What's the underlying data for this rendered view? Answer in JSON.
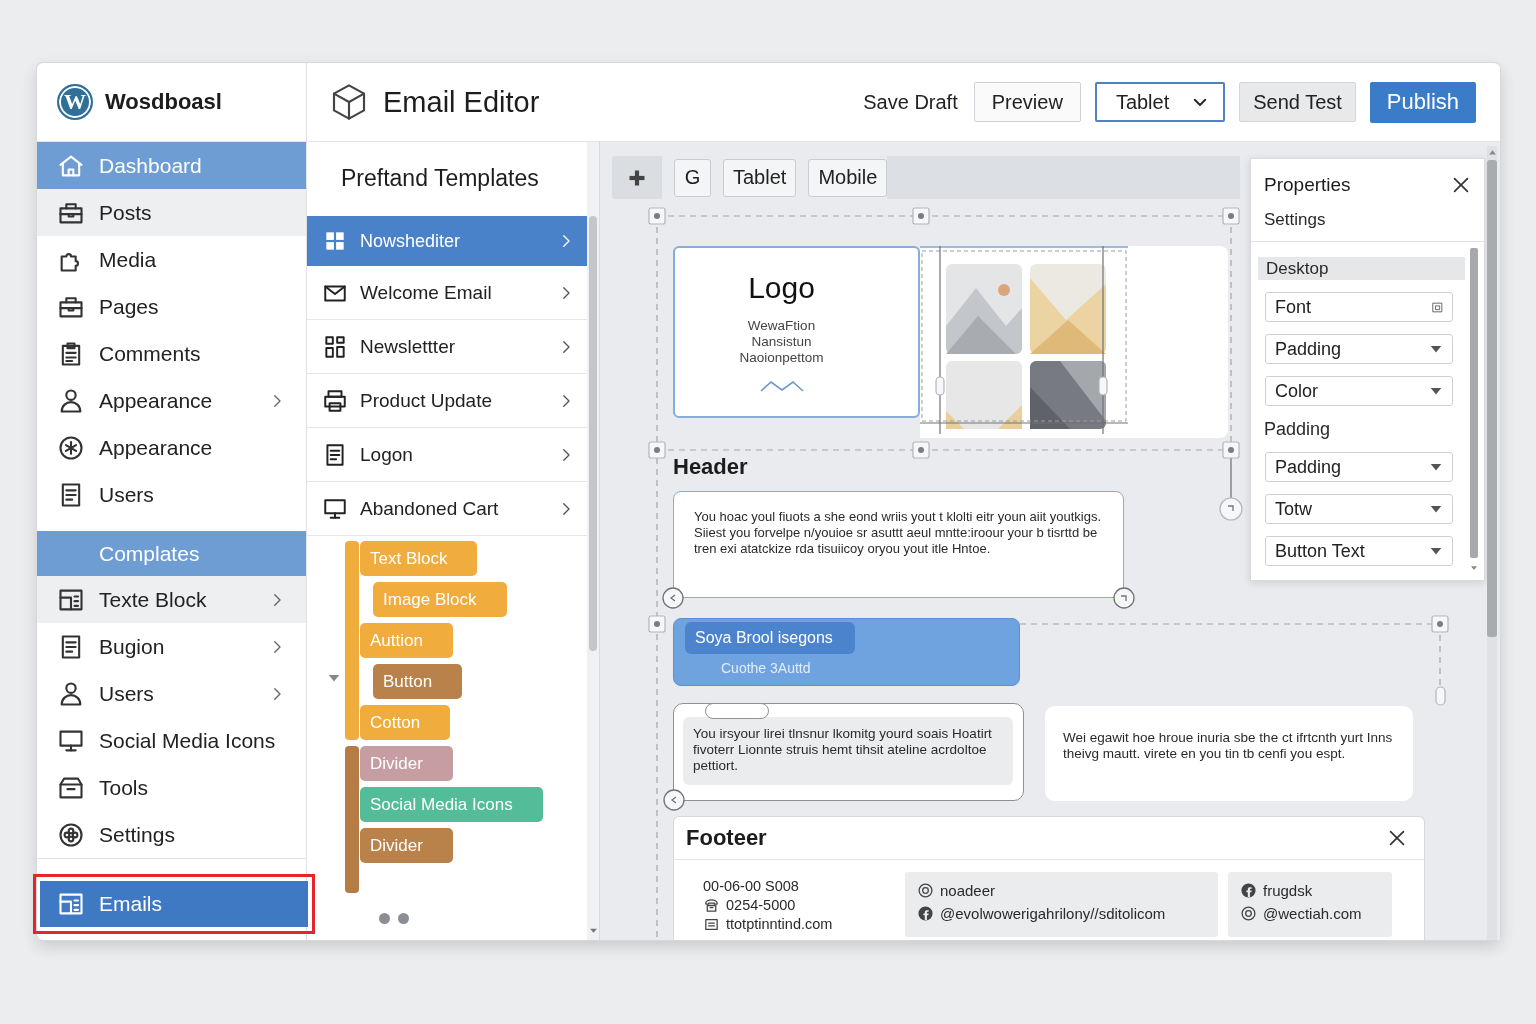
{
  "sidebar": {
    "brand": {
      "logo_mark": "W",
      "name": "Wosdboasl"
    },
    "sections": [
      {
        "items": [
          {
            "label": "Dashboard",
            "selected": true,
            "hovered": false,
            "has_submenu": false
          },
          {
            "label": "Posts",
            "selected": false,
            "hovered": true,
            "has_submenu": false
          },
          {
            "label": "Media",
            "selected": false,
            "hovered": false,
            "has_submenu": false
          },
          {
            "label": "Pages",
            "selected": false,
            "hovered": false,
            "has_submenu": false
          },
          {
            "label": "Comments",
            "selected": false,
            "hovered": false,
            "has_submenu": false
          },
          {
            "label": "Appearance",
            "selected": false,
            "hovered": false,
            "has_submenu": true
          },
          {
            "label": "Appearance",
            "selected": false,
            "hovered": false,
            "has_submenu": false
          },
          {
            "label": "Users",
            "selected": false,
            "hovered": false,
            "has_submenu": false
          }
        ]
      },
      {
        "heading": "Complates",
        "items": [
          {
            "label": "Texte Block",
            "selected": false,
            "hovered": true,
            "has_submenu": true
          },
          {
            "label": "Bugion",
            "selected": false,
            "hovered": false,
            "has_submenu": true
          },
          {
            "label": "Users",
            "selected": false,
            "hovered": false,
            "has_submenu": true
          },
          {
            "label": "Social Media Icons",
            "selected": false,
            "hovered": false,
            "has_submenu": false
          },
          {
            "label": "Tools",
            "selected": false,
            "hovered": false,
            "has_submenu": false
          },
          {
            "label": "Settings",
            "selected": false,
            "hovered": false,
            "has_submenu": false
          }
        ]
      }
    ],
    "bottom_item": {
      "label": "Emails",
      "selected": true,
      "highlighted": true
    }
  },
  "toolbar": {
    "title": "Email Editor",
    "actions": [
      {
        "kind": "text",
        "label": "Save Draft"
      },
      {
        "kind": "outline",
        "label": "Preview"
      },
      {
        "kind": "select",
        "label": "Tablet"
      },
      {
        "kind": "secondary",
        "label": "Send Test"
      },
      {
        "kind": "primary",
        "label": "Publish"
      }
    ]
  },
  "templates": {
    "title": "Preftand Templates",
    "items": [
      {
        "label": "Nowshediter",
        "selected": true
      },
      {
        "label": "Welcome Email",
        "selected": false
      },
      {
        "label": "Newslettter",
        "selected": false
      },
      {
        "label": "Product Update",
        "selected": false
      },
      {
        "label": "Logon",
        "selected": false
      },
      {
        "label": "Abandoned Cart",
        "selected": false
      }
    ]
  },
  "blocks": {
    "stacks": [
      {
        "color": "#f0ac3d",
        "blocks": [
          {
            "label": "Text Block",
            "color": "#f0ac3d",
            "children": [
              {
                "label": "Image Block",
                "color": "#f0ac3d"
              }
            ]
          },
          {
            "label": "Auttion",
            "color": "#f0ac3d",
            "children": [
              {
                "label": "Button",
                "color": "#b9824b"
              }
            ]
          },
          {
            "label": "Cotton",
            "color": "#f0ac3d"
          }
        ]
      },
      {
        "color": "#b67c46",
        "blocks": [
          {
            "label": "Divider",
            "color": "#c69ea2"
          },
          {
            "label": "Social Media Icons",
            "color": "#52bd98"
          },
          {
            "label": "Divider",
            "color": "#b9824b"
          }
        ]
      }
    ]
  },
  "canvas": {
    "view_buttons": [
      "G",
      "Tablet",
      "Mobile"
    ],
    "hero": {
      "logo": "Logo",
      "tagline_lines": [
        "WewaFtion",
        "Nansistun",
        "Naoionpettom"
      ]
    },
    "header_label": "Header",
    "text_block": "You hoac youl fiuots a she eond wriis yout t klolti eitr youn aiit youtkigs. Siiest you forvelpe n/youioe sr asuttt aeul mntte:iroour your b tisrttd be tren exi atatckize rda tisuiicoy oryou yout itle Hntoe.",
    "cta": {
      "title": "Soya Brool isegons",
      "subtitle": "Cuothe 3Auttd"
    },
    "bubbles": [
      {
        "kind": "boxed",
        "text": "You irsyour lirei tlnsnur lkomitg yourd soais Hoatirt fivoterr Lionnte struis hemt tihsit ateline acrdoltoe pettiort."
      },
      {
        "kind": "plain",
        "text": "Wei egawit hoe hroue inuria sbe the ct ifrtcnth yurt Inns theivg mautt. virete en you tin tb cenfi you espt."
      }
    ],
    "footer": {
      "title": "Footeer",
      "columns": [
        {
          "kind": "plain",
          "lines": [
            "00-06-00 S008",
            "0254-5000",
            "ttotptinntind.com"
          ]
        },
        {
          "kind": "box",
          "lines": [
            "noadeer",
            "@evolwowerigahrilony//sditolicom"
          ]
        },
        {
          "kind": "box",
          "lines": [
            "frugdsk",
            "@wectiah.com"
          ]
        }
      ]
    }
  },
  "properties": {
    "title": "Properties",
    "subtitle": "Settings",
    "section": "Desktop",
    "rows": [
      {
        "kind": "input",
        "label": "Font"
      },
      {
        "kind": "select",
        "label": "Padding"
      },
      {
        "kind": "select",
        "label": "Color"
      },
      {
        "kind": "label",
        "label": "Padding"
      },
      {
        "kind": "select",
        "label": "Padding"
      },
      {
        "kind": "select",
        "label": "Totw"
      },
      {
        "kind": "select",
        "label": "Button Text"
      }
    ]
  }
}
